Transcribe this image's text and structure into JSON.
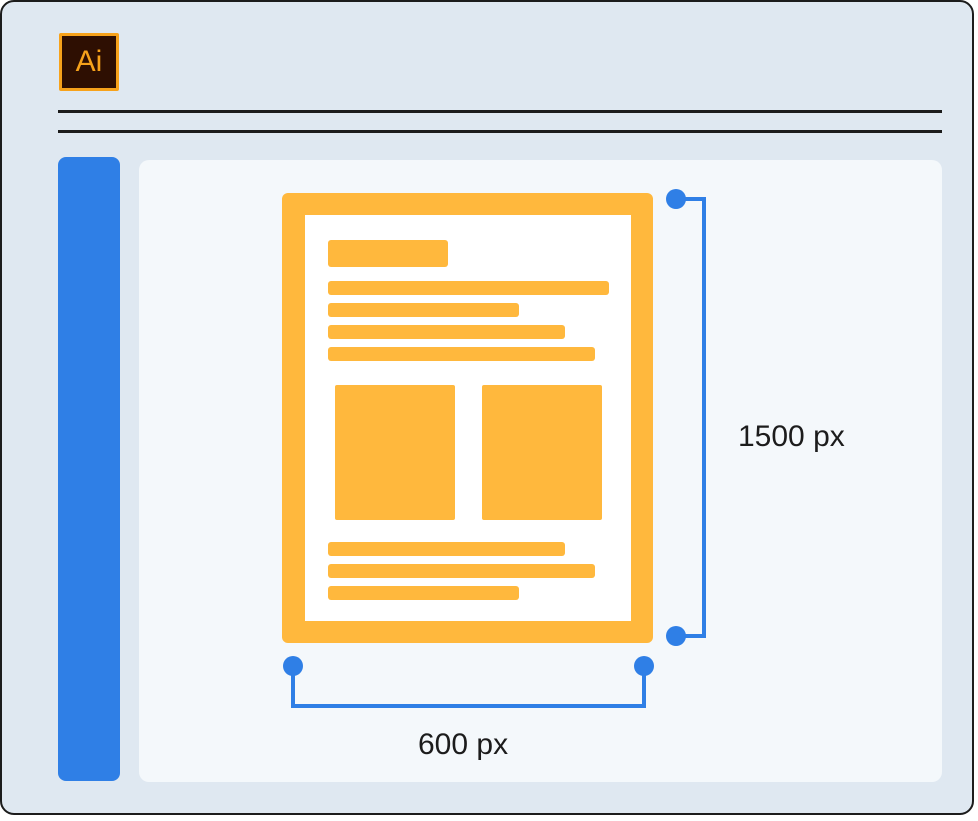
{
  "app": {
    "logo_text": "Ai",
    "logo_icon": "adobe-illustrator-icon"
  },
  "dimensions": {
    "height_label": "1500 px",
    "width_label": "600 px"
  },
  "colors": {
    "window_bg": "#dfe8f1",
    "sidebar": "#2f7fe6",
    "canvas": "#f4f8fb",
    "artboard": "#ffb83d",
    "measure": "#2f7fe6",
    "logo_bg": "#2e0f02",
    "logo_fg": "#f7a21b"
  }
}
